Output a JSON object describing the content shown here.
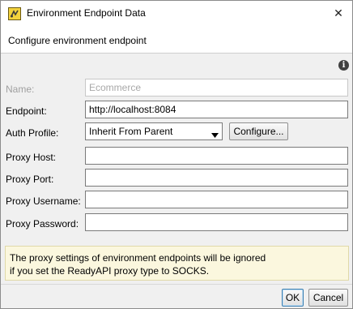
{
  "window": {
    "title": "Environment Endpoint Data",
    "close_glyph": "✕",
    "app_icon": "readyapi-app-icon"
  },
  "header": {
    "text": "Configure environment endpoint"
  },
  "info_icon": "info-icon",
  "form": {
    "name": {
      "label": "Name:",
      "value": "Ecommerce",
      "disabled": true
    },
    "endpoint": {
      "label": "Endpoint:",
      "value": "http://localhost:8084"
    },
    "auth_profile": {
      "label": "Auth Profile:",
      "selected": "Inherit From Parent",
      "configure_label": "Configure..."
    },
    "proxy_host": {
      "label": "Proxy Host:",
      "value": ""
    },
    "proxy_port": {
      "label": "Proxy Port:",
      "value": ""
    },
    "proxy_username": {
      "label": "Proxy Username:",
      "value": ""
    },
    "proxy_password": {
      "label": "Proxy Password:",
      "value": ""
    }
  },
  "notice": {
    "line1": "The proxy settings of environment endpoints will be ignored",
    "line2": "if you set the ReadyAPI proxy type to SOCKS."
  },
  "footer": {
    "ok_label": "OK",
    "cancel_label": "Cancel"
  },
  "colors": {
    "notice_background": "#fbf7de",
    "dialog_background": "#f0f0f0",
    "disabled_text": "#a0a0a0"
  }
}
